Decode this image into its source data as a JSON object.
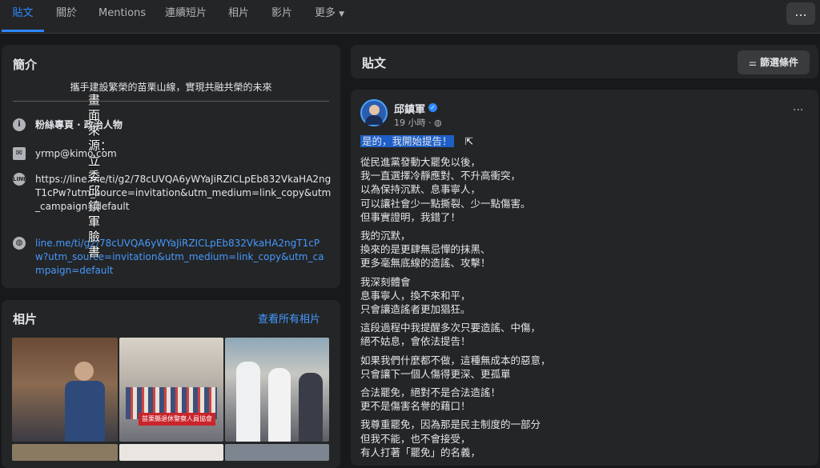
{
  "tabs": [
    "貼文",
    "關於",
    "Mentions",
    "連續短片",
    "相片",
    "影片",
    "更多"
  ],
  "more_menu": "...",
  "intro": {
    "title": "簡介",
    "bio": "攜手建設繁榮的苗栗山線，實現共融共榮的未來",
    "page_type": "粉絲專頁 · 政治人物",
    "email": "yrmp@kimo.com",
    "line_text": "https://line.me/ti/g2/78cUVQA6yWYaJiRZICLpEb832VkaHA2ngT1cPw?utm_source=invitation&utm_medium=link_copy&utm_campaign=default",
    "website": "line.me/ti/g2/78cUVQA6yWYaJiRZICLpEb832VkaHA2ngT1cPw?utm_source=invitation&utm_medium=link_copy&utm_campaign=default"
  },
  "watermark": "畫面來源：立委邱鎮軍臉書",
  "photos": {
    "title": "相片",
    "see_all": "查看所有相片",
    "banner_text": "苗栗縣退休警察人員協會"
  },
  "posts": {
    "title": "貼文",
    "filter": "篩選條件",
    "author": "邱鎮軍",
    "time": "19 小時 ·",
    "menu": "···",
    "highlight": "是的，我開始提告！",
    "paragraphs": [
      [
        "從民進黨發動大罷免以後，",
        "我一直選擇冷靜應對、不升高衝突，",
        "以為保持沉默、息事寧人，",
        "可以讓社會少一點撕裂、少一點傷害。",
        "但事實證明，我錯了！"
      ],
      [
        "我的沉默，",
        "換來的是更肆無忌憚的抹黑、",
        "更多毫無底線的造謠、攻擊！"
      ],
      [
        "我深刻體會",
        "息事寧人，換不來和平，",
        "只會讓造謠者更加猖狂。"
      ],
      [
        "這段過程中我提醒多次只要造謠、中傷，",
        "絕不姑息，會依法提告！"
      ],
      [
        "如果我們什麼都不做，這種無成本的惡意，",
        "只會讓下一個人傷得更深、更孤單"
      ],
      [
        "合法罷免，絕對不是合法造謠！",
        "更不是傷害名譽的藉口！"
      ],
      [
        "我尊重罷免，因為那是民主制度的一部分",
        "但我不能，也不會接受，",
        "有人打著「罷免」的名義，"
      ]
    ]
  }
}
